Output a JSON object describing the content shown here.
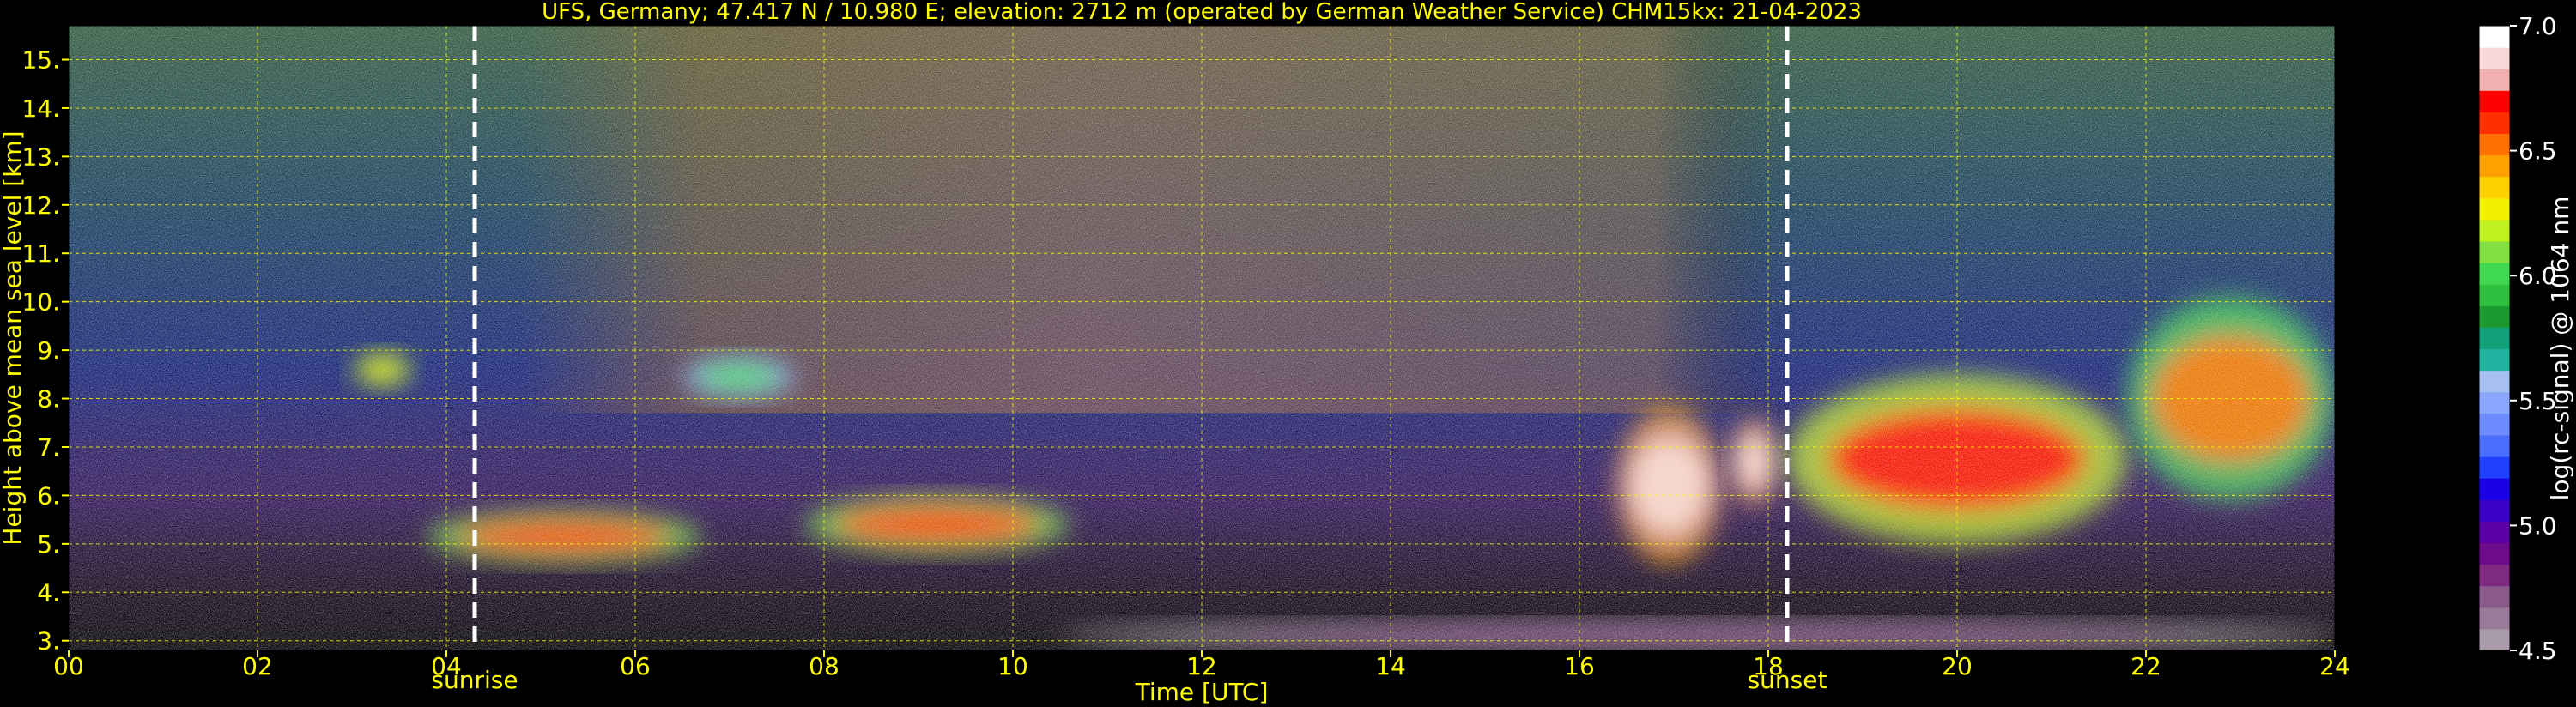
{
  "chart_data": {
    "type": "heatmap",
    "title": "UFS, Germany; 47.417 N / 10.980 E; elevation: 2712 m  (operated by German Weather Service)    CHM15kx: 21-04-2023",
    "xlabel": "Time [UTC]",
    "ylabel": "Height above mean sea level [km]",
    "xlim": [
      0,
      24
    ],
    "ylim": [
      2.8,
      15.7
    ],
    "x_ticks": [
      {
        "value": 0,
        "label": "00"
      },
      {
        "value": 2,
        "label": "02"
      },
      {
        "value": 4,
        "label": "04"
      },
      {
        "value": 6,
        "label": "06"
      },
      {
        "value": 8,
        "label": "08"
      },
      {
        "value": 10,
        "label": "10"
      },
      {
        "value": 12,
        "label": "12"
      },
      {
        "value": 14,
        "label": "14"
      },
      {
        "value": 16,
        "label": "16"
      },
      {
        "value": 18,
        "label": "18"
      },
      {
        "value": 20,
        "label": "20"
      },
      {
        "value": 22,
        "label": "22"
      },
      {
        "value": 24,
        "label": "24"
      }
    ],
    "y_ticks": [
      {
        "value": 3,
        "label": "3."
      },
      {
        "value": 4,
        "label": "4."
      },
      {
        "value": 5,
        "label": "5."
      },
      {
        "value": 6,
        "label": "6."
      },
      {
        "value": 7,
        "label": "7."
      },
      {
        "value": 8,
        "label": "8."
      },
      {
        "value": 9,
        "label": "9."
      },
      {
        "value": 10,
        "label": "10."
      },
      {
        "value": 11,
        "label": "11."
      },
      {
        "value": 12,
        "label": "12."
      },
      {
        "value": 13,
        "label": "13."
      },
      {
        "value": 14,
        "label": "14."
      },
      {
        "value": 15,
        "label": "15."
      }
    ],
    "grid": true,
    "events": [
      {
        "label": "sunrise",
        "time": 4.3
      },
      {
        "label": "sunset",
        "time": 18.2
      }
    ],
    "colorbar": {
      "label": "log(rc-signal) @ 1064 nm",
      "range": [
        4.5,
        7.0
      ],
      "ticks": [
        {
          "value": 4.5,
          "label": "4.5"
        },
        {
          "value": 5.0,
          "label": "5.0"
        },
        {
          "value": 5.5,
          "label": "5.5"
        },
        {
          "value": 6.0,
          "label": "6.0"
        },
        {
          "value": 6.5,
          "label": "6.5"
        },
        {
          "value": 7.0,
          "label": "7.0"
        }
      ],
      "colors": [
        "#a89aa8",
        "#9a7a9a",
        "#8a5a8a",
        "#7e2a80",
        "#6e0a8c",
        "#5a00a8",
        "#3a00c8",
        "#1a00e6",
        "#2040ff",
        "#4a6cff",
        "#6e8cff",
        "#8aa6ff",
        "#a6c0f0",
        "#20b4a0",
        "#10a07a",
        "#1a9a30",
        "#30c040",
        "#40d850",
        "#80e040",
        "#c0f020",
        "#f0f000",
        "#ffd000",
        "#ffa000",
        "#ff7000",
        "#ff3000",
        "#ff0000",
        "#f0b0b0",
        "#f8d8d8",
        "#ffffff"
      ]
    },
    "features": [
      {
        "name": "cloud",
        "t0": 3.0,
        "t1": 3.65,
        "h0": 8.2,
        "h1": 9.0,
        "level": 6.3
      },
      {
        "name": "cloud",
        "t0": 6.5,
        "t1": 7.7,
        "h0": 8.0,
        "h1": 8.9,
        "level": 6.0
      },
      {
        "name": "cloud",
        "t0": 3.8,
        "t1": 6.7,
        "h0": 4.6,
        "h1": 5.7,
        "level": 6.6
      },
      {
        "name": "cloud",
        "t0": 7.8,
        "t1": 10.6,
        "h0": 4.8,
        "h1": 6.0,
        "level": 6.6
      },
      {
        "name": "cloud",
        "t0": 16.4,
        "t1": 17.5,
        "h0": 4.6,
        "h1": 7.8,
        "level": 6.9
      },
      {
        "name": "cloud",
        "t0": 17.6,
        "t1": 18.1,
        "h0": 5.8,
        "h1": 7.6,
        "level": 6.9
      },
      {
        "name": "cloud",
        "t0": 18.2,
        "t1": 21.8,
        "h0": 5.0,
        "h1": 8.5,
        "level": 6.7
      },
      {
        "name": "cloud",
        "t0": 21.8,
        "t1": 24.0,
        "h0": 5.9,
        "h1": 10.1,
        "level": 6.5
      },
      {
        "name": "boundary-layer",
        "t0": 10.5,
        "t1": 24.0,
        "h0": 2.8,
        "h1": 3.4,
        "level": 4.8
      }
    ]
  }
}
